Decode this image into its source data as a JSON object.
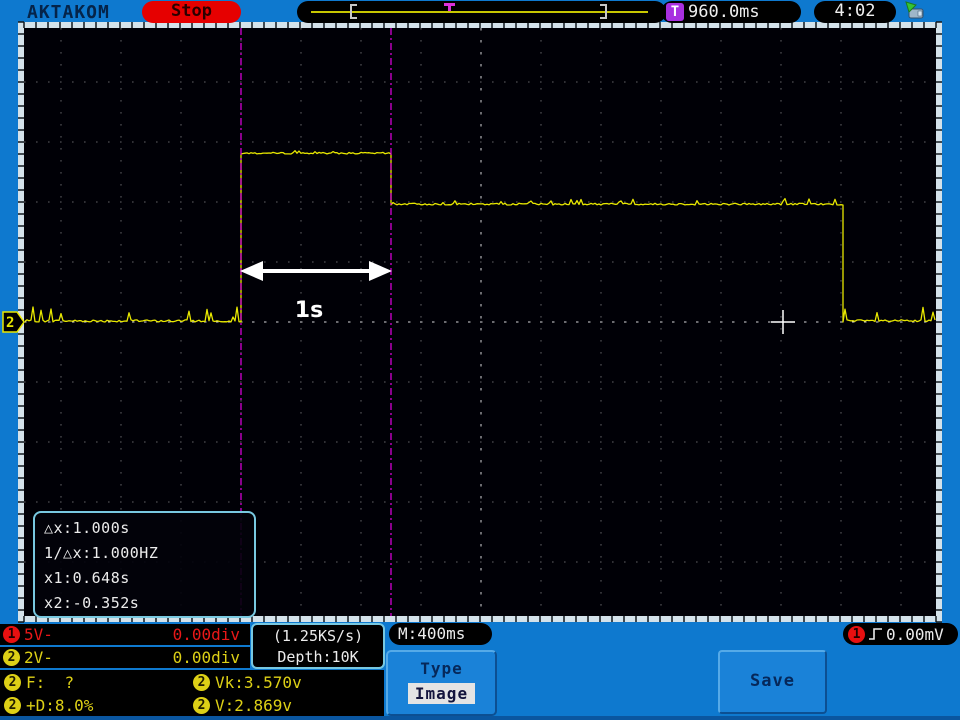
{
  "colors": {
    "background_blue": "#0e79cf",
    "screen_black": "#000006",
    "trace_yellow": "#e8e800",
    "cursor_magenta": "#e400e4",
    "ch1_red": "#e81818",
    "ch2_yellow": "#ddd016",
    "box_border_cyan": "#78c8e0",
    "stop_red": "#e60000"
  },
  "header": {
    "brand": "AKTAKOM",
    "run_state": "Stop",
    "trigger_time": {
      "icon": "T",
      "value": "960.0ms"
    },
    "clock": "4:02"
  },
  "screen": {
    "channel2_marker": "2",
    "annotation": "1s",
    "readout": {
      "lines": [
        "△x:1.000s",
        "1/△x:1.000HZ",
        "x1:0.648s",
        "x2:-0.352s"
      ]
    }
  },
  "footer": {
    "ch1": {
      "badge": "1",
      "scale": "5V-",
      "offset": "0.00div"
    },
    "ch2": {
      "badge": "2",
      "scale": "2V-",
      "offset": "0.00div"
    },
    "sampling": {
      "rate": "(1.25KS/s)",
      "depth": "Depth:10K"
    },
    "timebase": "M:400ms",
    "trigger": {
      "badge": "1",
      "edge": "rising-edge",
      "level": "0.00mV"
    },
    "measurements": [
      {
        "badge": "2",
        "text": "F:  ?"
      },
      {
        "badge": "2",
        "text": "+D:8.0%"
      },
      {
        "badge": "2",
        "text": "Vk:3.570v"
      },
      {
        "badge": "2",
        "text": "V:2.869v"
      }
    ],
    "type_button": {
      "label": "Type",
      "value": "Image"
    },
    "save_button": {
      "label": "Save"
    }
  },
  "chart_data": {
    "type": "line",
    "title": "Channel 2 pulse waveform",
    "x_units": "s",
    "y_units": "V",
    "seconds_per_div": 0.4,
    "volts_per_div": 2,
    "grid": "dotted, 60px per division",
    "segments": [
      {
        "t_start": -1.8,
        "t_end": -0.352,
        "level_v": 0.0
      },
      {
        "t_start": -0.352,
        "t_end": 0.648,
        "level_v": 5.6
      },
      {
        "t_start": 0.648,
        "t_end": 3.66,
        "level_v": 3.9
      },
      {
        "t_start": 3.66,
        "t_end": 4.28,
        "level_v": 0.0
      }
    ],
    "cursors": {
      "x1_s": 0.648,
      "x2_s": -0.352,
      "dx_s": 1.0,
      "one_over_dx_hz": 1.0
    },
    "trigger_marker": {
      "t_s": 3.26,
      "level_v": 0.0
    },
    "annotation": {
      "text": "1s",
      "between_cursors": true
    }
  }
}
